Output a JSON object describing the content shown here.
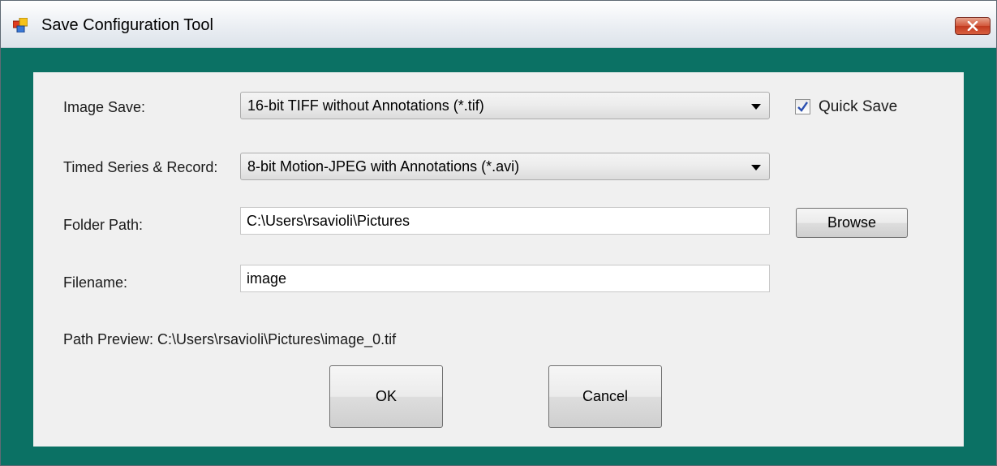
{
  "window": {
    "title": "Save Configuration Tool",
    "accent_color": "#0b7164",
    "icon": "app-window-icon"
  },
  "form": {
    "image_save": {
      "label": "Image Save:",
      "value": "16-bit TIFF without Annotations (*.tif)"
    },
    "quick_save": {
      "label": "Quick Save",
      "checked": true
    },
    "timed_series": {
      "label": "Timed Series & Record:",
      "value": "8-bit Motion-JPEG with Annotations (*.avi)"
    },
    "folder_path": {
      "label": "Folder Path:",
      "value": "C:\\Users\\rsavioli\\Pictures",
      "browse_label": "Browse"
    },
    "filename": {
      "label": "Filename:",
      "value": "image"
    },
    "path_preview": "Path Preview: C:\\Users\\rsavioli\\Pictures\\image_0.tif"
  },
  "buttons": {
    "ok_label": "OK",
    "cancel_label": "Cancel"
  }
}
